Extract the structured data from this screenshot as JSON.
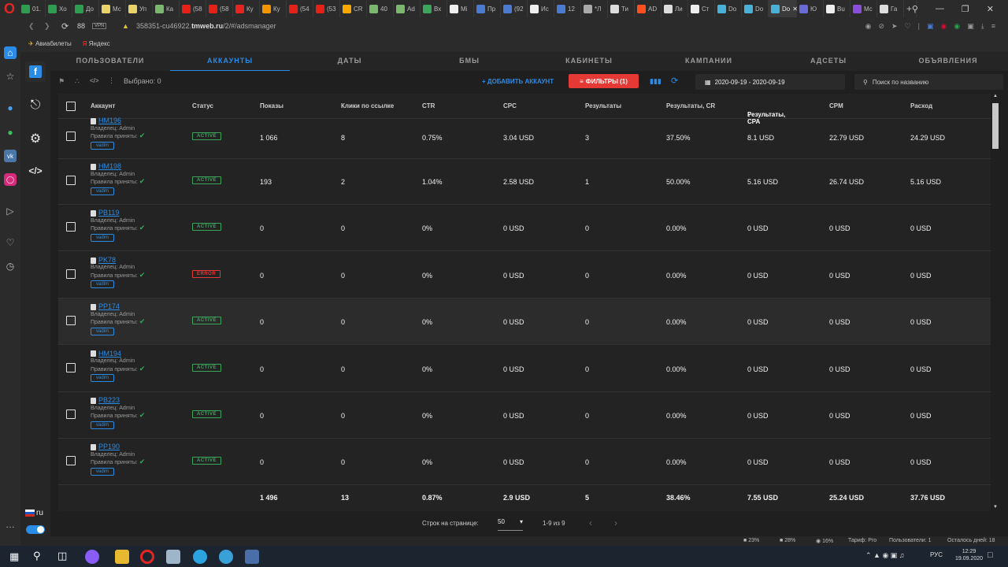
{
  "browser": {
    "tabs": [
      "01.",
      "Хо",
      "До",
      "Мс",
      "Уп",
      "Ка",
      "(58",
      "(58",
      "Ку",
      "Ку",
      "(54",
      "(53",
      "CR",
      "40",
      "Ad",
      "Вх",
      "Mi",
      "Пр",
      "(92",
      "Ис",
      "12",
      "*Л",
      "Ти",
      "AD",
      "Ли",
      "Ст",
      "Do",
      "Do",
      "Do",
      "Ю",
      "Bu",
      "Мс",
      "Га"
    ],
    "active_tab_index": 28,
    "tab_colors": [
      "#2e9d4f",
      "#2e9d4f",
      "#2e9d4f",
      "#e8d26a",
      "#e8d26a",
      "#7ab86e",
      "#e62117",
      "#e62117",
      "#e52620",
      "#f29500",
      "#e62117",
      "#e62117",
      "#f6a800",
      "#7ab86e",
      "#7ab86e",
      "#3ba55c",
      "#eeeeee",
      "#4a7bd1",
      "#4a7bd1",
      "#eeeeee",
      "#4a7bd1",
      "#aaaaaa",
      "#dddddd",
      "#ff4f1f",
      "#dddddd",
      "#eeeeee",
      "#4ab0d8",
      "#4ab0d8",
      "#4ab0d8",
      "#6b6bd8",
      "#eeeeee",
      "#8a4fd8",
      "#dddddd"
    ],
    "url_host_prefix": "358351-cu46922.",
    "url_host_bold": "tmweb.ru",
    "url_path": "/2/#/adsmanager",
    "tab_count_label": "88",
    "vpn_label": "VPN",
    "bookmarks": [
      "Авиабилеты",
      "Яндекс"
    ]
  },
  "nav_tabs": [
    "ПОЛЬЗОВАТЕЛИ",
    "АККАУНТЫ",
    "ДАТЫ",
    "БМЫ",
    "КАБИНЕТЫ",
    "КАМПАНИИ",
    "АДСЕТЫ",
    "ОБЪЯВЛЕНИЯ"
  ],
  "nav_selected": "АККАУНТЫ",
  "toolbar": {
    "selected_label": "Выбрано: 0",
    "add_account": "ДОБАВИТЬ АККАУНТ",
    "filters": "ФИЛЬТРЫ (1)",
    "date_range": "2020-09-19 - 2020-09-19",
    "search_placeholder": "Поиск по названию"
  },
  "table": {
    "headers": [
      "Аккаунт",
      "Статус",
      "Показы",
      "Клики по ссылке",
      "CTR",
      "CPC",
      "Результаты",
      "Результаты, CR",
      "Результаты, CPA",
      "CPM",
      "Расход"
    ],
    "rows": [
      {
        "name": "HM196",
        "owner": "Владелец: Admin",
        "rules": "Правила приняты:",
        "tag": "vadim",
        "status": "ACTIVE",
        "impressions": "1 066",
        "clicks": "8",
        "ctr": "0.75%",
        "cpc": "3.04 USD",
        "results": "3",
        "cr": "37.50%",
        "cpa": "8.1 USD",
        "cpm": "22.79 USD",
        "spend": "24.29 USD"
      },
      {
        "name": "HM198",
        "owner": "Владелец: Admin",
        "rules": "Правила приняты:",
        "tag": "vadim",
        "status": "ACTIVE",
        "impressions": "193",
        "clicks": "2",
        "ctr": "1.04%",
        "cpc": "2.58 USD",
        "results": "1",
        "cr": "50.00%",
        "cpa": "5.16 USD",
        "cpm": "26.74 USD",
        "spend": "5.16 USD"
      },
      {
        "name": "PB119",
        "owner": "Владелец: Admin",
        "rules": "Правила приняты:",
        "tag": "vadim",
        "status": "ACTIVE",
        "impressions": "0",
        "clicks": "0",
        "ctr": "0%",
        "cpc": "0 USD",
        "results": "0",
        "cr": "0.00%",
        "cpa": "0 USD",
        "cpm": "0 USD",
        "spend": "0 USD"
      },
      {
        "name": "PK78",
        "owner": "Владелец: Admin",
        "rules": "Правила приняты:",
        "tag": "vadim",
        "status": "ERROR",
        "impressions": "0",
        "clicks": "0",
        "ctr": "0%",
        "cpc": "0 USD",
        "results": "0",
        "cr": "0.00%",
        "cpa": "0 USD",
        "cpm": "0 USD",
        "spend": "0 USD"
      },
      {
        "name": "PP174",
        "owner": "Владелец: Admin",
        "rules": "Правила приняты:",
        "tag": "vadim",
        "status": "ACTIVE",
        "impressions": "0",
        "clicks": "0",
        "ctr": "0%",
        "cpc": "0 USD",
        "results": "0",
        "cr": "0.00%",
        "cpa": "0 USD",
        "cpm": "0 USD",
        "spend": "0 USD"
      },
      {
        "name": "HM194",
        "owner": "Владелец: Admin",
        "rules": "Правила приняты:",
        "tag": "vadim",
        "status": "ACTIVE",
        "impressions": "0",
        "clicks": "0",
        "ctr": "0%",
        "cpc": "0 USD",
        "results": "0",
        "cr": "0.00%",
        "cpa": "0 USD",
        "cpm": "0 USD",
        "spend": "0 USD"
      },
      {
        "name": "PB223",
        "owner": "Владелец: Admin",
        "rules": "Правила приняты:",
        "tag": "vadim",
        "status": "ACTIVE",
        "impressions": "0",
        "clicks": "0",
        "ctr": "0%",
        "cpc": "0 USD",
        "results": "0",
        "cr": "0.00%",
        "cpa": "0 USD",
        "cpm": "0 USD",
        "spend": "0 USD"
      },
      {
        "name": "PP190",
        "owner": "Владелец: Admin",
        "rules": "Правила приняты:",
        "tag": "vadim",
        "status": "ACTIVE",
        "impressions": "0",
        "clicks": "0",
        "ctr": "0%",
        "cpc": "0 USD",
        "results": "0",
        "cr": "0.00%",
        "cpa": "0 USD",
        "cpm": "0 USD",
        "spend": "0 USD"
      }
    ],
    "totals": {
      "impressions": "1 496",
      "clicks": "13",
      "ctr": "0.87%",
      "cpc": "2.9 USD",
      "results": "5",
      "cr": "38.46%",
      "cpa": "7.55 USD",
      "cpm": "25.24 USD",
      "spend": "37.76 USD"
    }
  },
  "pagination": {
    "rows_label": "Строк на странице:",
    "rows_value": "50",
    "range": "1-9 из 9"
  },
  "statusbar": {
    "cpu": "23%",
    "mem": "28%",
    "disk": "16%",
    "tariff": "Тариф: Pro",
    "users": "Пользователи: 1",
    "days_left": "Осталось дней: 18"
  },
  "sidebar": {
    "lang": "ru"
  },
  "taskbar": {
    "lang": "РУС",
    "time": "12:29",
    "date": "19.09.2020"
  }
}
